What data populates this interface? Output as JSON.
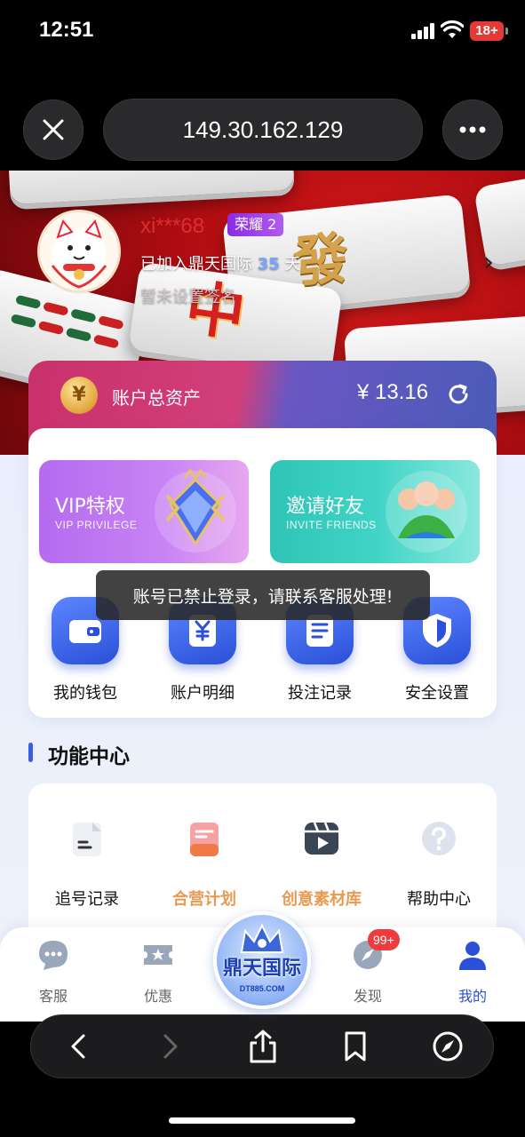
{
  "status_bar": {
    "time": "12:51",
    "battery": "18+"
  },
  "browser": {
    "url": "149.30.162.129"
  },
  "profile": {
    "username": "xi***68",
    "rank": "荣耀 2",
    "joined_prefix": "已加入鼎天国际",
    "joined_days": "35",
    "joined_suffix": "天",
    "signature": "暂未设置签名"
  },
  "assets": {
    "label": "账户总资产",
    "value": "¥ 13.16",
    "coin_symbol": "¥"
  },
  "promos": {
    "vip": {
      "title": "VIP特权",
      "subtitle": "VIP PRIVILEGE"
    },
    "invite": {
      "title": "邀请好友",
      "subtitle": "INVITE FRIENDS"
    }
  },
  "toast": "账号已禁止登录，请联系客服处理!",
  "quick_actions": [
    {
      "label": "我的钱包",
      "icon": "wallet-icon"
    },
    {
      "label": "账户明细",
      "icon": "yen-document-icon"
    },
    {
      "label": "投注记录",
      "icon": "records-icon"
    },
    {
      "label": "安全设置",
      "icon": "shield-icon"
    }
  ],
  "function_center": {
    "title": "功能中心",
    "items": [
      {
        "label": "追号记录",
        "icon": "document-icon"
      },
      {
        "label": "合营计划",
        "icon": "plan-icon"
      },
      {
        "label": "创意素材库",
        "icon": "video-library-icon"
      },
      {
        "label": "帮助中心",
        "icon": "help-icon"
      }
    ]
  },
  "tabs": [
    {
      "label": "客服",
      "icon": "chat-icon"
    },
    {
      "label": "优惠",
      "icon": "coupon-icon"
    },
    {
      "label": "发现",
      "icon": "compass-icon",
      "badge": "99+"
    },
    {
      "label": "我的",
      "icon": "user-icon",
      "active": true
    }
  ],
  "center_logo": {
    "title": "鼎天国际",
    "domain": "DT885.COM"
  },
  "colors": {
    "accent": "#2b4fd8",
    "badge": "#ef3b3b",
    "orange_label": "#e99a52"
  }
}
